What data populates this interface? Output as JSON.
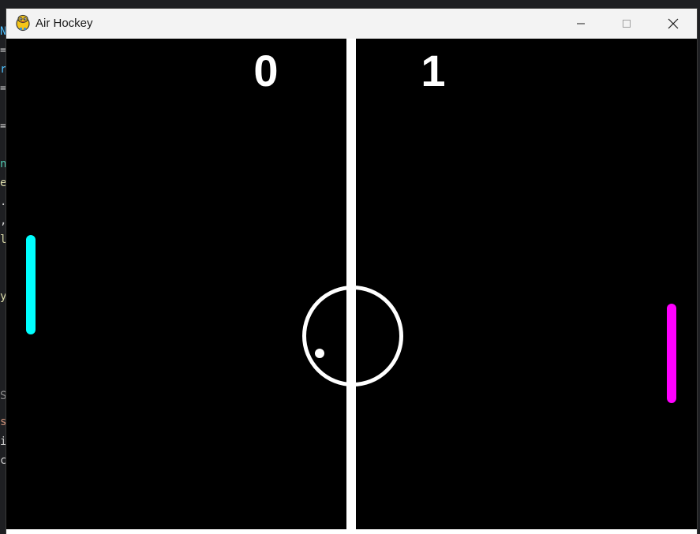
{
  "window": {
    "title": "Air Hockey",
    "icon": "python-icon"
  },
  "controls": {
    "minimize_icon": "minimize-icon",
    "maximize_icon": "maximize-icon",
    "close_icon": "close-icon"
  },
  "game": {
    "score_left": "0",
    "score_right": "1",
    "colors": {
      "background": "#000000",
      "lines": "#ffffff",
      "left_paddle": "#00ffff",
      "right_paddle": "#ff00ff",
      "puck": "#ffffff"
    }
  },
  "background_editor": {
    "glyphs": [
      {
        "text": "N",
        "color": "#4fc1ff"
      },
      {
        "text": "=",
        "color": "#d4d4d4"
      },
      {
        "text": "r",
        "color": "#4fc1ff"
      },
      {
        "text": "=",
        "color": "#d4d4d4"
      },
      {
        "text": "=",
        "color": "#d4d4d4"
      },
      {
        "text": "n",
        "color": "#4ec9b0"
      },
      {
        "text": "e",
        "color": "#dcdcaa"
      },
      {
        "text": ".",
        "color": "#d4d4d4"
      },
      {
        "text": ",",
        "color": "#d4d4d4"
      },
      {
        "text": "l",
        "color": "#dcdcaa"
      },
      {
        "text": "y",
        "color": "#dcdcaa"
      },
      {
        "text": "S",
        "color": "#8a8a8a"
      },
      {
        "text": "s",
        "color": "#ce9178"
      },
      {
        "text": "i",
        "color": "#cccccc"
      },
      {
        "text": "c",
        "color": "#cccccc"
      }
    ]
  }
}
